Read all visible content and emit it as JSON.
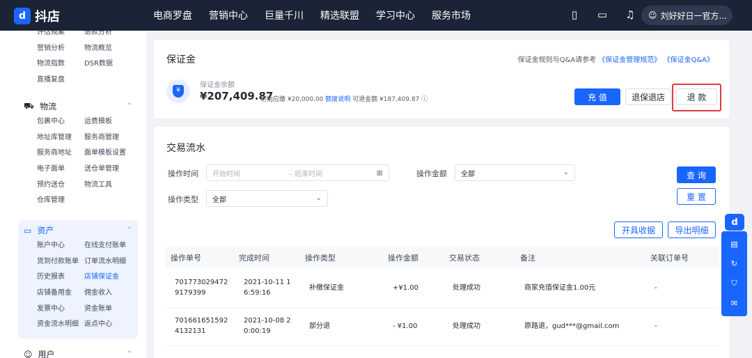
{
  "brand": {
    "name": "抖店",
    "logo_mark": "d"
  },
  "nav": [
    "电商罗盘",
    "营销中心",
    "巨量千川",
    "精选联盟",
    "学习中心",
    "服务市场"
  ],
  "user": {
    "name": "刘好好日一官方..."
  },
  "icons": {
    "phone": "phone-icon",
    "chat": "chat-icon",
    "bell": "bell-icon",
    "avatar": "user-icon"
  },
  "sidebar": {
    "group_top": [
      "评估规案",
      "退款分析",
      "营销分析",
      "物流概览",
      "物流指数",
      "DSR数据",
      "直播复盘",
      ""
    ],
    "logistics": {
      "title": "物流",
      "items": [
        "包裹中心",
        "运费模板",
        "地址库管理",
        "服务商管理",
        "服务商地址",
        "面单模板设置",
        "电子面单",
        "送仓单管理",
        "预约送仓",
        "物流工具",
        "仓库管理",
        ""
      ]
    },
    "assets": {
      "title": "资产",
      "items": [
        "账户中心",
        "在线支付账单",
        "货到付款账单",
        "订单流水明细",
        "历史报表",
        "店铺保证金",
        "店铺备用金",
        "佣金收入",
        "发票中心",
        "资金账单",
        "资金流水明细",
        "返点中心"
      ]
    },
    "users": {
      "title": "用户"
    }
  },
  "deposit": {
    "title": "保证金",
    "rules_prefix": "保证金规则与Q&A请参考",
    "rules_link1": "《保证金管理规范》",
    "rules_link2": "《保证金Q&A》",
    "balance_label": "保证金余额",
    "balance": "¥207,409.87",
    "initial_due": "初始应缴 ¥20,000.00",
    "quota_link": "额度说明",
    "refundable": "可退金额 ¥187,409.87",
    "buttons": {
      "recharge": "充 值",
      "withdraw_store": "退保退店",
      "refund": "退 款"
    }
  },
  "transactions": {
    "title": "交易流水",
    "filters": {
      "time_label": "操作时间",
      "start_placeholder": "开始时间",
      "end_placeholder": "– 结束时间",
      "amount_label": "操作金额",
      "amount_value": "全部",
      "type_label": "操作类型",
      "type_value": "全部",
      "query": "查 询",
      "reset": "重 置"
    },
    "actions": {
      "invoice": "开具收据",
      "export": "导出明细"
    },
    "columns": [
      "操作单号",
      "完成时间",
      "操作类型",
      "操作金额",
      "交易状态",
      "备注",
      "关联订单号"
    ],
    "rows": [
      {
        "id": "701773029472\n9179399",
        "time": "2021-10-11 1\n6:59:16",
        "type": "补缴保证金",
        "amount": "+¥1.00",
        "status": "处理成功",
        "note": "商家充值保证金1.00元",
        "order": "-"
      },
      {
        "id": "701661651592\n4132131",
        "time": "2021-10-08 2\n0:00:19",
        "type": "部分退",
        "amount": "- ¥1.00",
        "status": "处理成功",
        "note": "原路退，gud***@gmail.com",
        "order": "-"
      }
    ]
  },
  "float_bar": {
    "logo": "d",
    "icons": [
      "book-icon",
      "headset-icon",
      "shield-icon",
      "mail-icon"
    ]
  }
}
